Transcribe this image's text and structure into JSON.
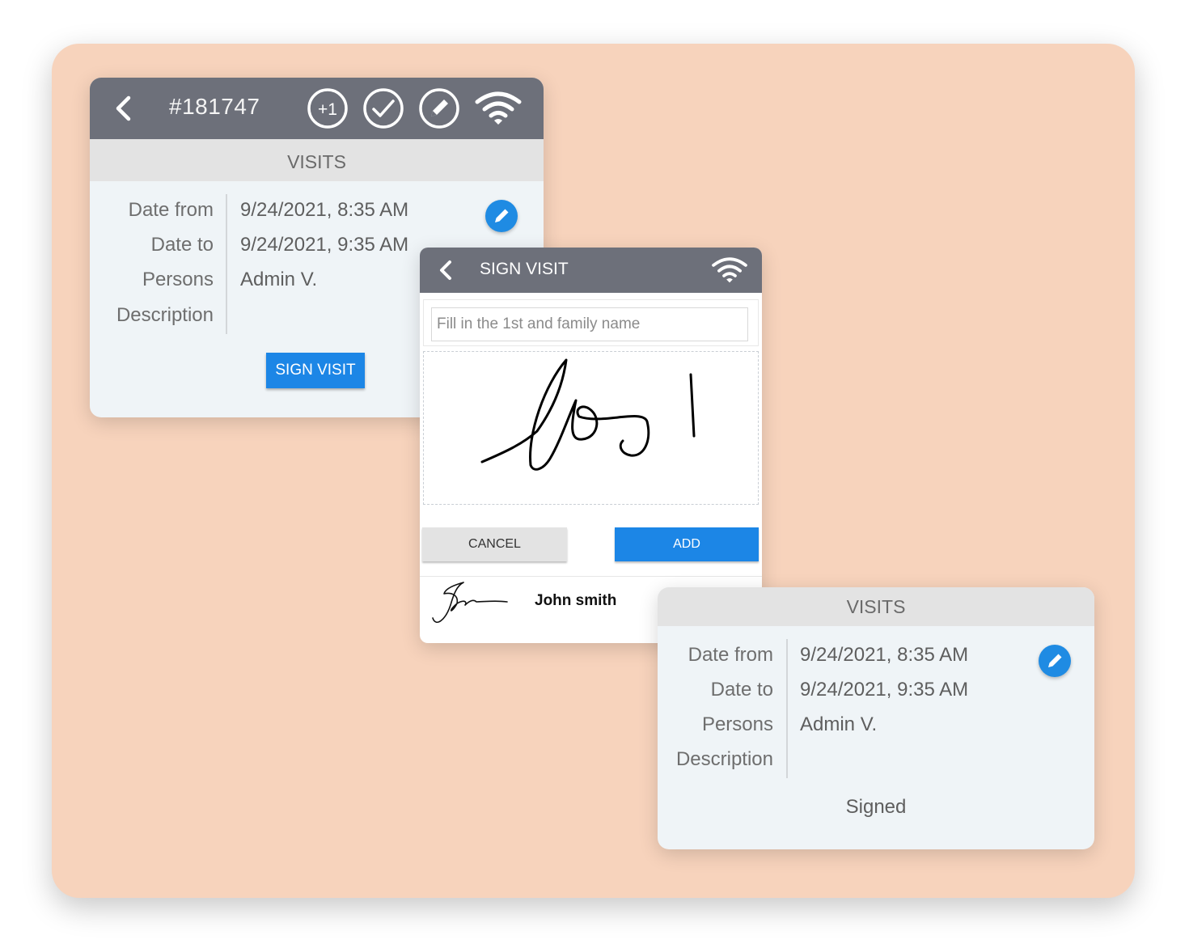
{
  "visit_card": {
    "ticket_number": "#181747",
    "header_icons": [
      "plus-one-icon",
      "check-circle-icon",
      "edit-circle-icon",
      "wifi-icon"
    ],
    "plus_one_label": "+1",
    "section_title": "VISITS",
    "fields": [
      {
        "label": "Date from",
        "value": "9/24/2021, 8:35 AM"
      },
      {
        "label": "Date to",
        "value": "9/24/2021, 9:35 AM"
      },
      {
        "label": "Persons",
        "value": "Admin V."
      },
      {
        "label": "Description",
        "value": ""
      }
    ],
    "sign_button_label": "SIGN VISIT"
  },
  "sign_dialog": {
    "title": "SIGN VISIT",
    "name_placeholder": "Fill in the 1st and family name",
    "cancel_label": "CANCEL",
    "add_label": "ADD",
    "saved_signer_name": "John smith"
  },
  "signed_card": {
    "section_title": "VISITS",
    "fields": [
      {
        "label": "Date from",
        "value": "9/24/2021, 8:35 AM"
      },
      {
        "label": "Date to",
        "value": "9/24/2021, 9:35 AM"
      },
      {
        "label": "Persons",
        "value": "Admin V."
      },
      {
        "label": "Description",
        "value": ""
      }
    ],
    "status_text": "Signed"
  },
  "colors": {
    "backdrop": "#f7d3bc",
    "toolbar": "#6d707a",
    "accent_blue": "#1c86e6",
    "card_bg": "#eff4f7"
  }
}
